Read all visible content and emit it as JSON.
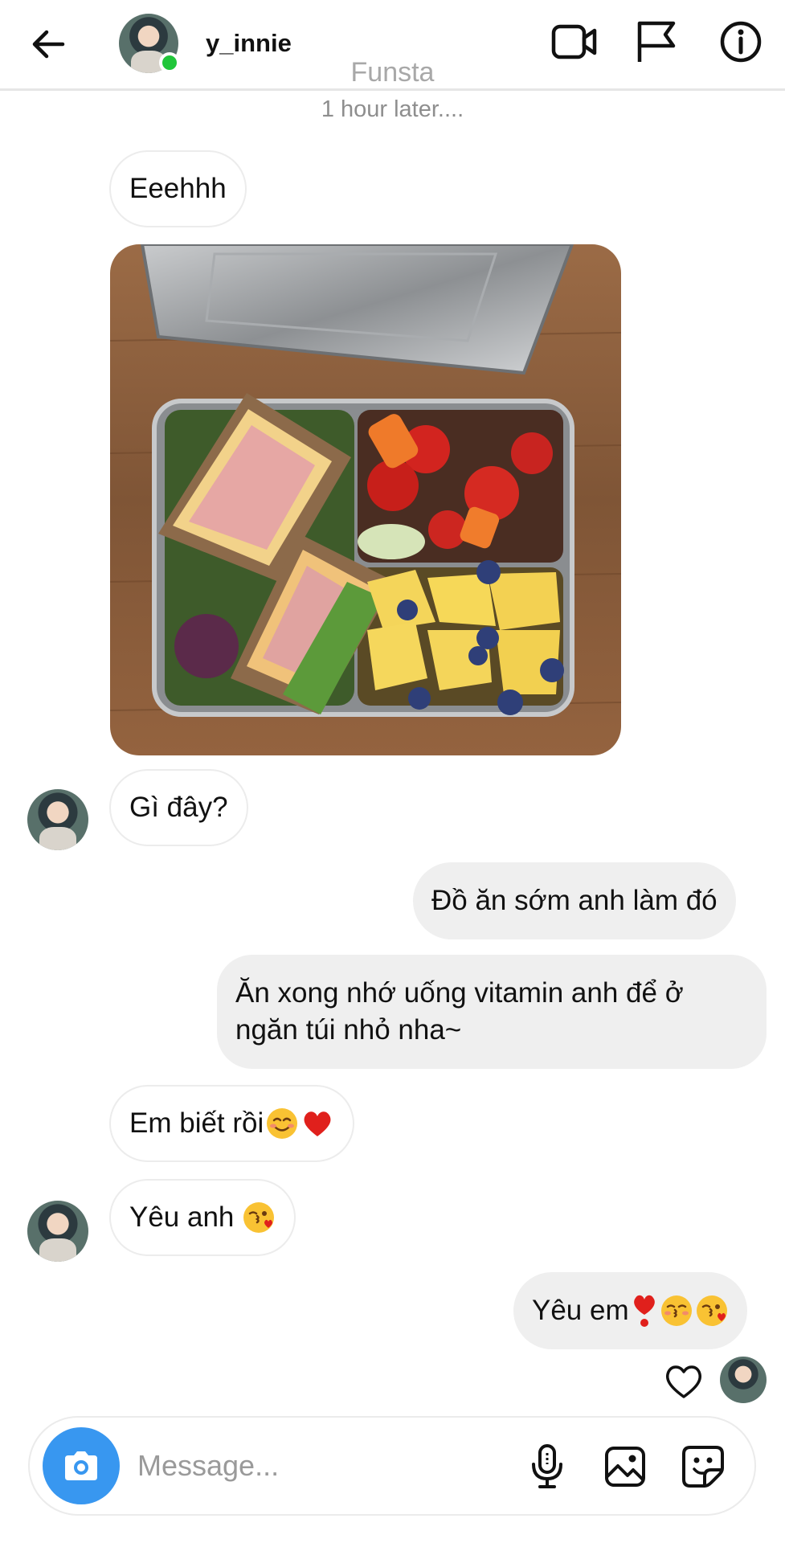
{
  "header": {
    "username": "y_innie",
    "back_icon": "arrow-left-icon",
    "video_icon": "video-camera-icon",
    "report_icon": "flag-icon",
    "info_icon": "info-icon",
    "online": true
  },
  "thread": {
    "account_label": "Funsta",
    "time_note": "1 hour later...."
  },
  "messages": [
    {
      "from": "them",
      "text": "Eeehhh"
    },
    {
      "from": "them",
      "type": "photo",
      "icon": "lunchbox-photo"
    },
    {
      "from": "them",
      "text": "Gì đây?"
    },
    {
      "from": "me",
      "text": "Đồ ăn sớm anh làm đó"
    },
    {
      "from": "me",
      "text_line1": "Ăn xong nhớ uống vitamin anh để ở",
      "text_line2": "ngăn túi nhỏ nha~"
    },
    {
      "from": "them",
      "text": "Em biết rồi",
      "emojis": [
        "smiling-face-emoji",
        "red-heart-emoji"
      ]
    },
    {
      "from": "them",
      "text": "Yêu anh",
      "emojis": [
        "face-blowing-kiss-emoji"
      ]
    },
    {
      "from": "me",
      "text": "Yêu em",
      "emojis": [
        "heart-exclamation-emoji",
        "kissing-face-emoji",
        "face-blowing-kiss-emoji"
      ]
    }
  ],
  "composer": {
    "placeholder": "Message...",
    "camera_icon": "camera-icon",
    "mic_icon": "microphone-icon",
    "gallery_icon": "image-icon",
    "sticker_icon": "sticker-icon"
  },
  "colors": {
    "accent": "#3897f0",
    "online": "#20c63a",
    "outgoing_bubble": "#efefef",
    "incoming_border": "#ececec"
  }
}
